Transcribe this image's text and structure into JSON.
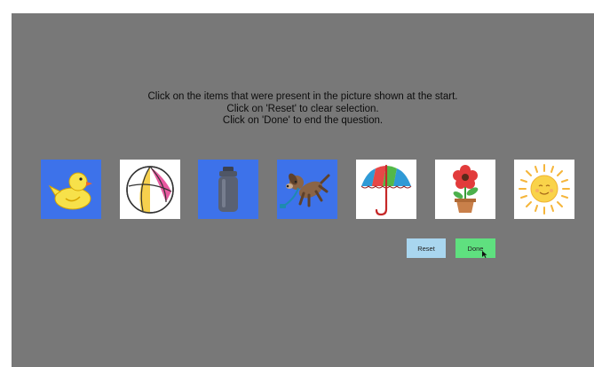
{
  "instructions": {
    "line1": "Click on the items that were present in the picture shown at the start.",
    "line2": "Click on 'Reset' to clear selection.",
    "line3": "Click on 'Done' to end the question."
  },
  "items": [
    {
      "name": "duck",
      "selected": true
    },
    {
      "name": "beach-ball",
      "selected": false
    },
    {
      "name": "thermos",
      "selected": true
    },
    {
      "name": "dog",
      "selected": true
    },
    {
      "name": "umbrella",
      "selected": false
    },
    {
      "name": "flower-pot",
      "selected": false
    },
    {
      "name": "sun",
      "selected": false
    }
  ],
  "buttons": {
    "reset_label": "Reset",
    "done_label": "Done"
  },
  "colors": {
    "background": "#787878",
    "selected_tile": "#3d72ea",
    "unselected_tile": "#ffffff",
    "reset_button": "#a9d6ef",
    "done_button": "#5fe07f"
  }
}
